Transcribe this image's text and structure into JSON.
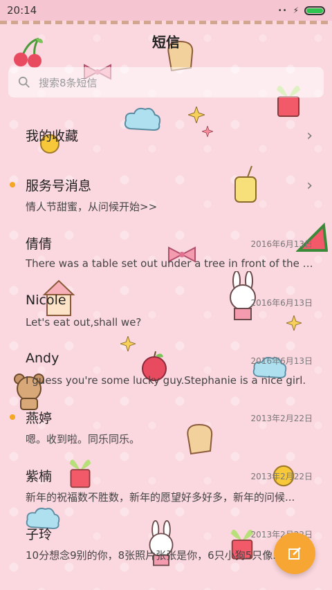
{
  "status": {
    "time": "20:14",
    "signal_dots": "••",
    "charging": "⚡"
  },
  "header": {
    "title": "短信"
  },
  "search": {
    "placeholder": "搜索8条短信"
  },
  "conversations": [
    {
      "name": "我的收藏",
      "preview": "",
      "date": "",
      "unread": false,
      "chevron": "›"
    },
    {
      "name": "服务号消息",
      "preview": "情人节甜蜜，从问候开始>>",
      "date": "",
      "unread": true,
      "chevron": "›"
    },
    {
      "name": "倩倩",
      "preview": "There was a table set out under a tree in front of the ho...",
      "date": "2016年6月13日",
      "unread": false
    },
    {
      "name": "Nicole",
      "preview": "Let's eat out,shall we?",
      "date": "2016年6月13日",
      "unread": false
    },
    {
      "name": "Andy",
      "preview": "I guess you're some lucky guy.Stephanie is a nice girl.",
      "date": "2016年6月13日",
      "unread": false
    },
    {
      "name": "燕婷",
      "preview": "嗯。收到啦。同乐同乐。",
      "date": "2013年2月22日",
      "unread": true
    },
    {
      "name": "紫楠",
      "preview": "新年的祝福数不胜数，新年的愿望好多好多，新年的问候...",
      "date": "2013年2月22日",
      "unread": false
    },
    {
      "name": "子玲",
      "preview": "10分想念9别的你，8张照片张张是你，6只小狗5只像...",
      "date": "2013年2月22日",
      "unread": false
    }
  ],
  "colors": {
    "accent": "#f7a634",
    "unread_dot": "#f5a623",
    "background": "#fbd7df"
  },
  "icons": {
    "search": "search-icon",
    "compose": "compose-icon"
  }
}
